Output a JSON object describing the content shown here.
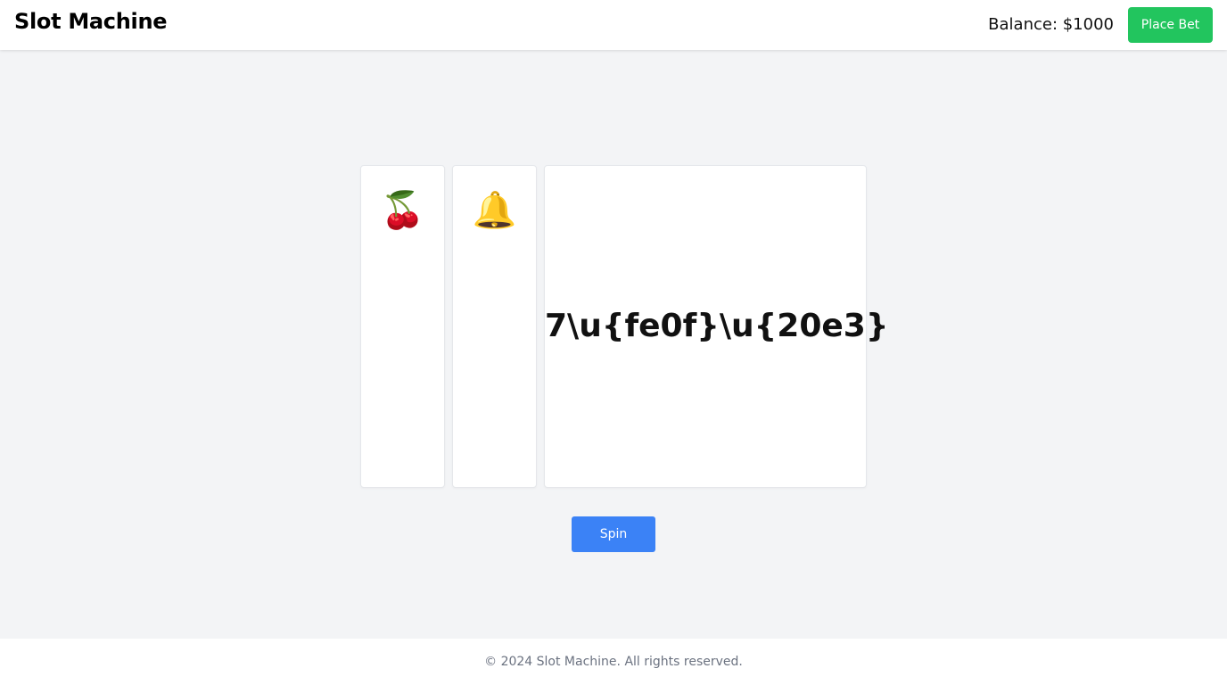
{
  "header": {
    "title": "Slot Machine",
    "balance_text": "Balance: $1000",
    "place_bet_label": "Place Bet"
  },
  "reels": [
    {
      "symbol": "🍒",
      "icon": "cherry-icon"
    },
    {
      "symbol": "🔔",
      "icon": "bell-icon"
    },
    {
      "symbol": "7\\u{fe0f}\\u{20e3}"
    }
  ],
  "controls": {
    "spin_label": "Spin"
  },
  "footer": {
    "text": "© 2024 Slot Machine. All rights reserved."
  },
  "colors": {
    "accent_green": "#22c55e",
    "accent_blue": "#3b82f6",
    "background": "#f3f4f6"
  }
}
